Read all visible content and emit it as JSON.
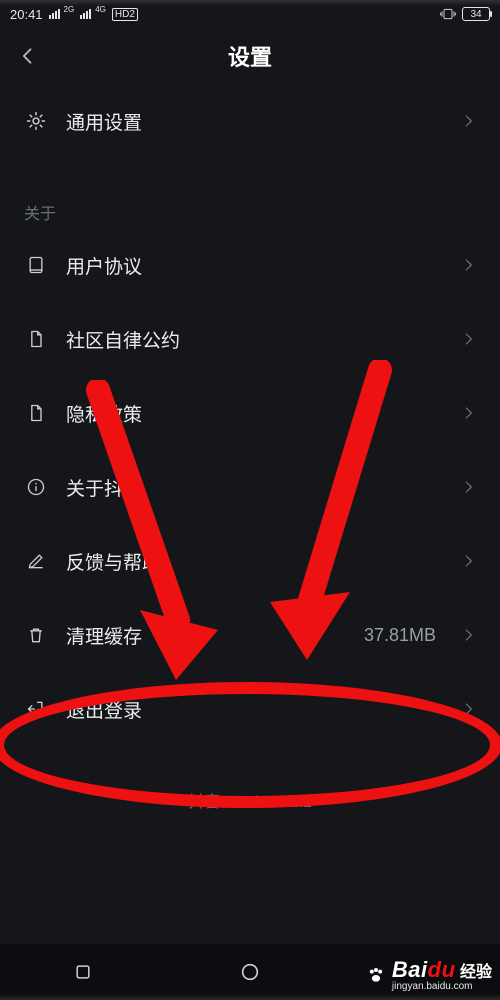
{
  "status": {
    "time": "20:41",
    "net2g": "2G",
    "net4g": "4G",
    "hd": "HD2",
    "battery": "34"
  },
  "header": {
    "title": "设置"
  },
  "rows": {
    "general": "通用设置",
    "section_about": "关于",
    "user_agreement": "用户协议",
    "community": "社区自律公约",
    "privacy": "隐私政策",
    "about_app": "关于抖音",
    "feedback": "反馈与帮助",
    "clear_cache": "清理缓存",
    "cache_value": "37.81MB",
    "logout": "退出登录"
  },
  "footer": {
    "version": "抖音 version8.1.1"
  },
  "watermark": {
    "brand": "Bai",
    "brand2": "du",
    "cn": "经验",
    "url": "jingyan.baidu.com"
  }
}
